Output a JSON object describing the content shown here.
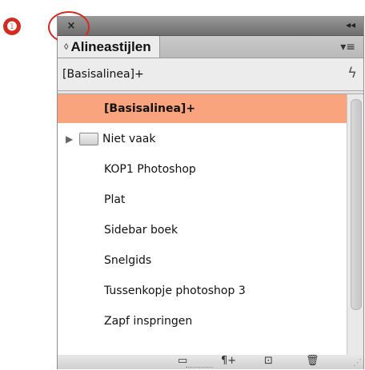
{
  "callout": {
    "number": "❶"
  },
  "panel": {
    "close_glyph": "×",
    "collapse_glyph": "◂◂",
    "tab_title": "Alineastijlen",
    "tab_arrows": "◊",
    "menu_glyph": "▾≡",
    "current_style": "[Basisalinea]+",
    "lightning_glyph": "ϟ",
    "items": [
      {
        "label": "[Basisalinea]+",
        "selected": true
      },
      {
        "label": "Niet vaak",
        "folder": true
      },
      {
        "label": "KOP1 Photoshop"
      },
      {
        "label": "Plat"
      },
      {
        "label": "Sidebar boek"
      },
      {
        "label": "Snelgids"
      },
      {
        "label": "Tussenkopje photoshop 3"
      },
      {
        "label": "Zapf inspringen"
      }
    ],
    "bottom_buttons": {
      "new_group": "▭",
      "clear_overrides": "¶+",
      "new_style": "⊡",
      "delete": "🗑"
    },
    "accent_color": "#f9a47c",
    "callout_color": "#d42a20"
  }
}
